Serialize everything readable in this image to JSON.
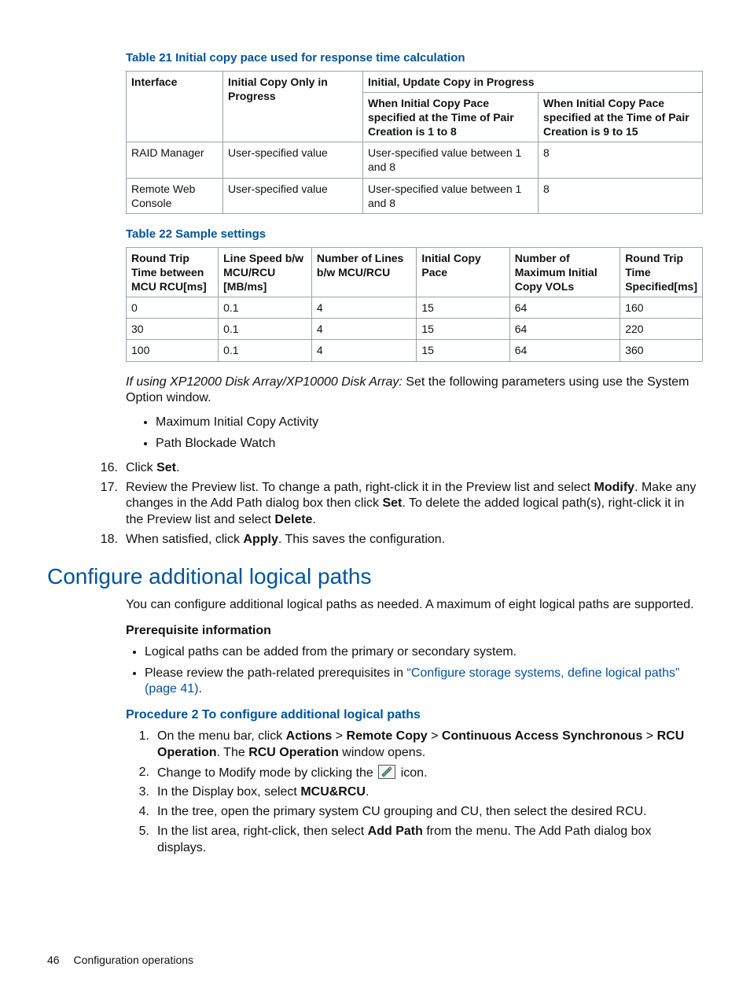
{
  "tables": {
    "t21": {
      "caption": "Table 21 Initial copy pace used for response time calculation",
      "head": {
        "interface": "Interface",
        "only": "Initial Copy Only in Progress",
        "both": "Initial, Update Copy in Progress",
        "sub_a": "When Initial Copy Pace specified at the Time of Pair Creation is 1 to 8",
        "sub_b": "When Initial Copy Pace specified at the Time of Pair Creation is 9 to 15"
      },
      "rows": [
        {
          "if": "RAID Manager",
          "only": "User-specified value",
          "a": "User-specified value between 1 and 8",
          "b": "8"
        },
        {
          "if": "Remote Web Console",
          "only": "User-specified value",
          "a": "User-specified value between 1 and 8",
          "b": "8"
        }
      ]
    },
    "t22": {
      "caption": "Table 22 Sample settings",
      "head": {
        "c0": "Round Trip Time between MCU RCU[ms]",
        "c1": "Line Speed b/w MCU/RCU [MB/ms]",
        "c2": "Number of Lines b/w MCU/RCU",
        "c3": "Initial Copy Pace",
        "c4": "Number of Maximum Initial Copy VOLs",
        "c5": "Round Trip Time Specified[ms]"
      },
      "rows": [
        {
          "c0": "0",
          "c1": "0.1",
          "c2": "4",
          "c3": "15",
          "c4": "64",
          "c5": "160"
        },
        {
          "c0": "30",
          "c1": "0.1",
          "c2": "4",
          "c3": "15",
          "c4": "64",
          "c5": "220"
        },
        {
          "c0": "100",
          "c1": "0.1",
          "c2": "4",
          "c3": "15",
          "c4": "64",
          "c5": "360"
        }
      ]
    }
  },
  "para_after_t22": {
    "italic": "If using XP12000 Disk Array/XP10000 Disk Array:",
    "rest": " Set the following parameters using use the System Option window."
  },
  "bullets_after_t22": [
    "Maximum Initial Copy Activity",
    "Path Blockade Watch"
  ],
  "steps_16_18": [
    {
      "n": "16.",
      "pre": "Click ",
      "b": "Set",
      "post": "."
    },
    {
      "n": "17.",
      "full": "Review the Preview list. To change a path, right-click it in the Preview list and select Modify. Make any changes in the Add Path dialog box then click Set. To delete the added logical path(s), right-click it in the Preview list and select Delete.",
      "parts": [
        "Review the Preview list. To change a path, right-click it in the Preview list and select ",
        "Modify",
        ". Make any changes in the Add Path dialog box then click ",
        "Set",
        ". To delete the added logical path(s), right-click it in the Preview list and select ",
        "Delete",
        "."
      ]
    },
    {
      "n": "18.",
      "pre": "When satisfied, click ",
      "b": "Apply",
      "post": ". This saves the configuration."
    }
  ],
  "section_heading": "Configure additional logical paths",
  "section_intro": "You can configure additional logical paths as needed. A maximum of eight logical paths are supported.",
  "prereq_head": "Prerequisite information",
  "prereq_bullets": [
    {
      "text": "Logical paths can be added from the primary or secondary system."
    },
    {
      "text_pre": "Please review the path-related prerequisites in ",
      "link": "“Configure storage systems, define logical paths” (page 41)",
      "text_post": "."
    }
  ],
  "proc_head": "Procedure 2 To configure additional logical paths",
  "proc_steps": [
    {
      "n": "1.",
      "parts": [
        "On the menu bar, click ",
        {
          "b": "Actions"
        },
        " > ",
        {
          "b": "Remote Copy"
        },
        " > ",
        {
          "b": "Continuous Access Synchronous"
        },
        " > ",
        {
          "b": "RCU Operation"
        },
        ". The ",
        {
          "b": "RCU Operation"
        },
        " window opens."
      ]
    },
    {
      "n": "2.",
      "parts": [
        "Change to Modify mode by clicking the ",
        {
          "icon": "modify-icon"
        },
        " icon."
      ]
    },
    {
      "n": "3.",
      "parts": [
        "In the Display box, select ",
        {
          "b": "MCU&RCU"
        },
        "."
      ]
    },
    {
      "n": "4.",
      "parts": [
        "In the tree, open the primary system CU grouping and CU, then select the desired RCU."
      ]
    },
    {
      "n": "5.",
      "parts": [
        "In the list area, right-click, then select ",
        {
          "b": "Add Path"
        },
        " from the menu. The Add Path dialog box displays."
      ]
    }
  ],
  "footer": {
    "page": "46",
    "section": "Configuration operations"
  }
}
